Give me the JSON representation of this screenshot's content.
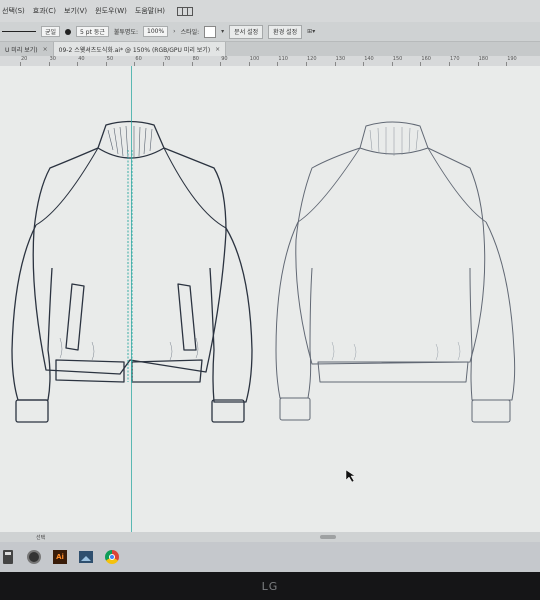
{
  "menu": {
    "items": [
      "선택(S)",
      "효과(C)",
      "보기(V)",
      "윈도우(W)",
      "도움말(H)"
    ]
  },
  "control_bar": {
    "stroke_style": "균일",
    "brush": "5 pt 둥근",
    "opacity_label": "불투명도:",
    "opacity_value": "100%",
    "style_label": "스타일:",
    "doc_setup": "문서 설정",
    "prefs": "환경 설정"
  },
  "tabs": [
    {
      "label": "U 미리 보기)"
    },
    {
      "label": "09-2 스웻셔츠도식화.ai* @ 150% (RGB/GPU 미리 보기)"
    }
  ],
  "ruler": {
    "labels": [
      "20",
      "30",
      "40",
      "50",
      "60",
      "70",
      "80",
      "90",
      "100",
      "110",
      "120",
      "130",
      "140",
      "150",
      "160",
      "170",
      "180",
      "190"
    ]
  },
  "status": {
    "tool": "선택"
  },
  "taskbar": {
    "icons": [
      "calculator-icon",
      "photos-icon",
      "illustrator-icon",
      "image-viewer-icon",
      "chrome-icon"
    ],
    "ai_label": "Ai"
  },
  "monitor": {
    "brand": "LG"
  }
}
